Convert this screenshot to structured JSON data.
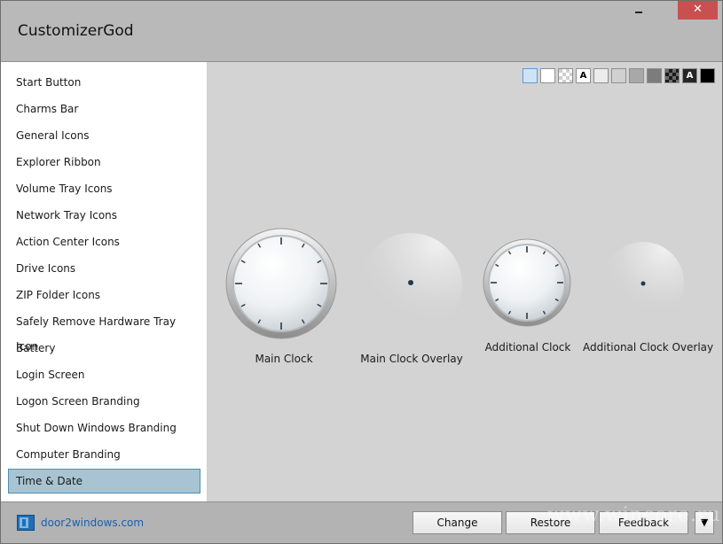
{
  "window": {
    "title": "CustomizerGod",
    "close_symbol": "✕"
  },
  "sidebar": {
    "items": [
      {
        "label": "Start Button"
      },
      {
        "label": "Charms Bar"
      },
      {
        "label": "General Icons"
      },
      {
        "label": "Explorer Ribbon"
      },
      {
        "label": "Volume Tray Icons"
      },
      {
        "label": "Network Tray Icons"
      },
      {
        "label": "Action Center Icons"
      },
      {
        "label": "Drive Icons"
      },
      {
        "label": "ZIP Folder Icons"
      },
      {
        "label": "Safely Remove Hardware Tray Icon"
      },
      {
        "label": "Battery"
      },
      {
        "label": "Login Screen"
      },
      {
        "label": "Logon Screen Branding"
      },
      {
        "label": "Shut Down Windows Branding"
      },
      {
        "label": "Computer Branding"
      },
      {
        "label": "Time & Date",
        "selected": true
      }
    ]
  },
  "backgrounds": {
    "swatches": [
      {
        "color": "#cfe3f7",
        "selected": true
      },
      {
        "color": "#ffffff"
      },
      {
        "color": "checker"
      },
      {
        "color": "#ffffff",
        "letter": "A",
        "letter_color": "#000000"
      },
      {
        "color": "#ececec"
      },
      {
        "color": "#d0d0d0"
      },
      {
        "color": "#a8a8a8"
      },
      {
        "color": "#7c7c7c"
      },
      {
        "color": "checker-dark"
      },
      {
        "color": "#262626",
        "letter": "A",
        "letter_color": "#ffffff"
      },
      {
        "color": "#000000"
      }
    ]
  },
  "resources": [
    {
      "label": "Main Clock",
      "icon": "clock-face-icon"
    },
    {
      "label": "Main Clock Overlay",
      "icon": "clock-overlay-icon"
    },
    {
      "label": "Additional Clock",
      "icon": "clock-face-icon"
    },
    {
      "label": "Additional Clock Overlay",
      "icon": "clock-overlay-icon"
    }
  ],
  "footer": {
    "link": "door2windows.com",
    "buttons": {
      "change": "Change",
      "restore": "Restore",
      "feedback": "Feedback",
      "dropdown": "▼"
    },
    "watermark": "www.wincore.ru"
  }
}
